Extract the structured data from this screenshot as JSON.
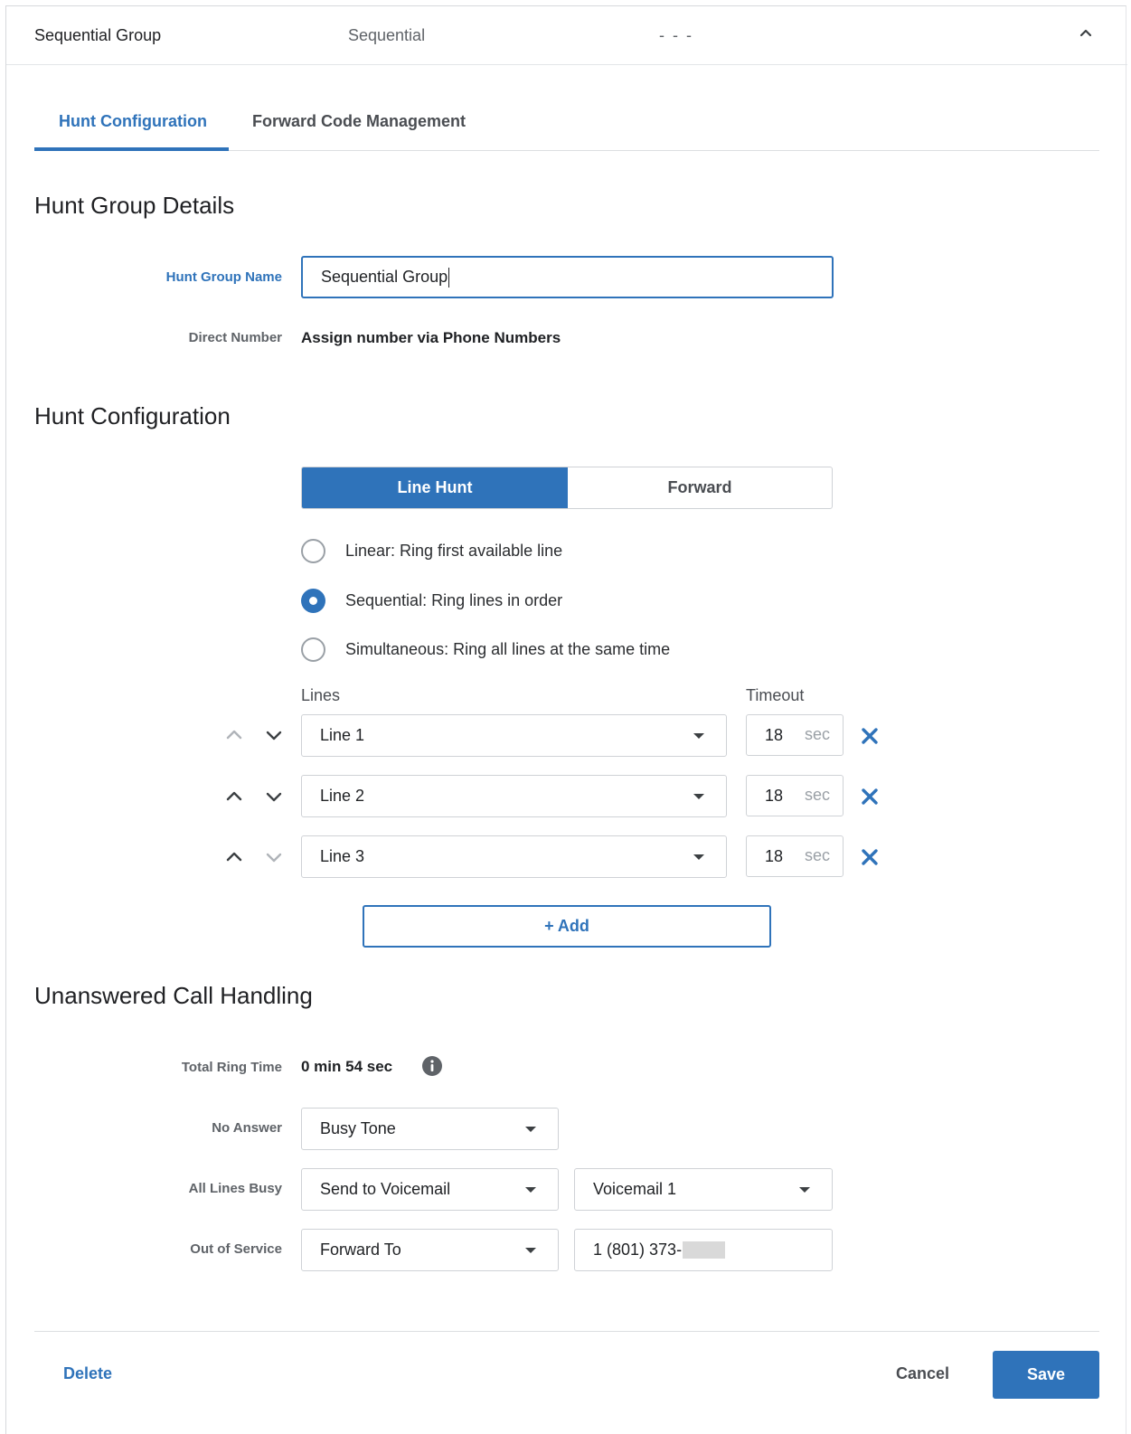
{
  "header": {
    "name": "Sequential Group",
    "type": "Sequential",
    "placeholder_dash": "- - -",
    "collapse_icon": "chevron-up-icon"
  },
  "tabs": [
    {
      "label": "Hunt Configuration",
      "active": true
    },
    {
      "label": "Forward Code Management",
      "active": false
    }
  ],
  "details": {
    "title": "Hunt Group Details",
    "name_label": "Hunt Group Name",
    "name_value": "Sequential Group",
    "direct_label": "Direct Number",
    "direct_value": "Assign number via Phone Numbers"
  },
  "config": {
    "title": "Hunt Configuration",
    "mode_options": [
      "Line Hunt",
      "Forward"
    ],
    "selected_mode": "Line Hunt",
    "strategies": [
      {
        "label": "Linear: Ring first available line",
        "checked": false
      },
      {
        "label": "Sequential: Ring lines in order",
        "checked": true
      },
      {
        "label": "Simultaneous: Ring all lines at the same time",
        "checked": false
      }
    ],
    "lines_header": "Lines",
    "timeout_header": "Timeout",
    "lines": [
      {
        "name": "Line 1",
        "timeout": "18",
        "unit": "sec"
      },
      {
        "name": "Line 2",
        "timeout": "18",
        "unit": "sec"
      },
      {
        "name": "Line 3",
        "timeout": "18",
        "unit": "sec"
      }
    ],
    "add_label": "+ Add"
  },
  "unanswered": {
    "title": "Unanswered Call Handling",
    "total_ring_label": "Total Ring Time",
    "total_ring_value": "0 min 54 sec",
    "no_answer_label": "No Answer",
    "no_answer_value": "Busy Tone",
    "all_busy_label": "All Lines Busy",
    "all_busy_value": "Send to Voicemail",
    "all_busy_target": "Voicemail 1",
    "out_of_service_label": "Out of Service",
    "out_of_service_value": "Forward To",
    "out_of_service_number": "1 (801) 373-"
  },
  "footer": {
    "delete_label": "Delete",
    "cancel_label": "Cancel",
    "save_label": "Save"
  },
  "colors": {
    "accent": "#2f73ba",
    "border": "#cfd2d6",
    "text": "#1f2124",
    "muted": "#5f6368"
  }
}
